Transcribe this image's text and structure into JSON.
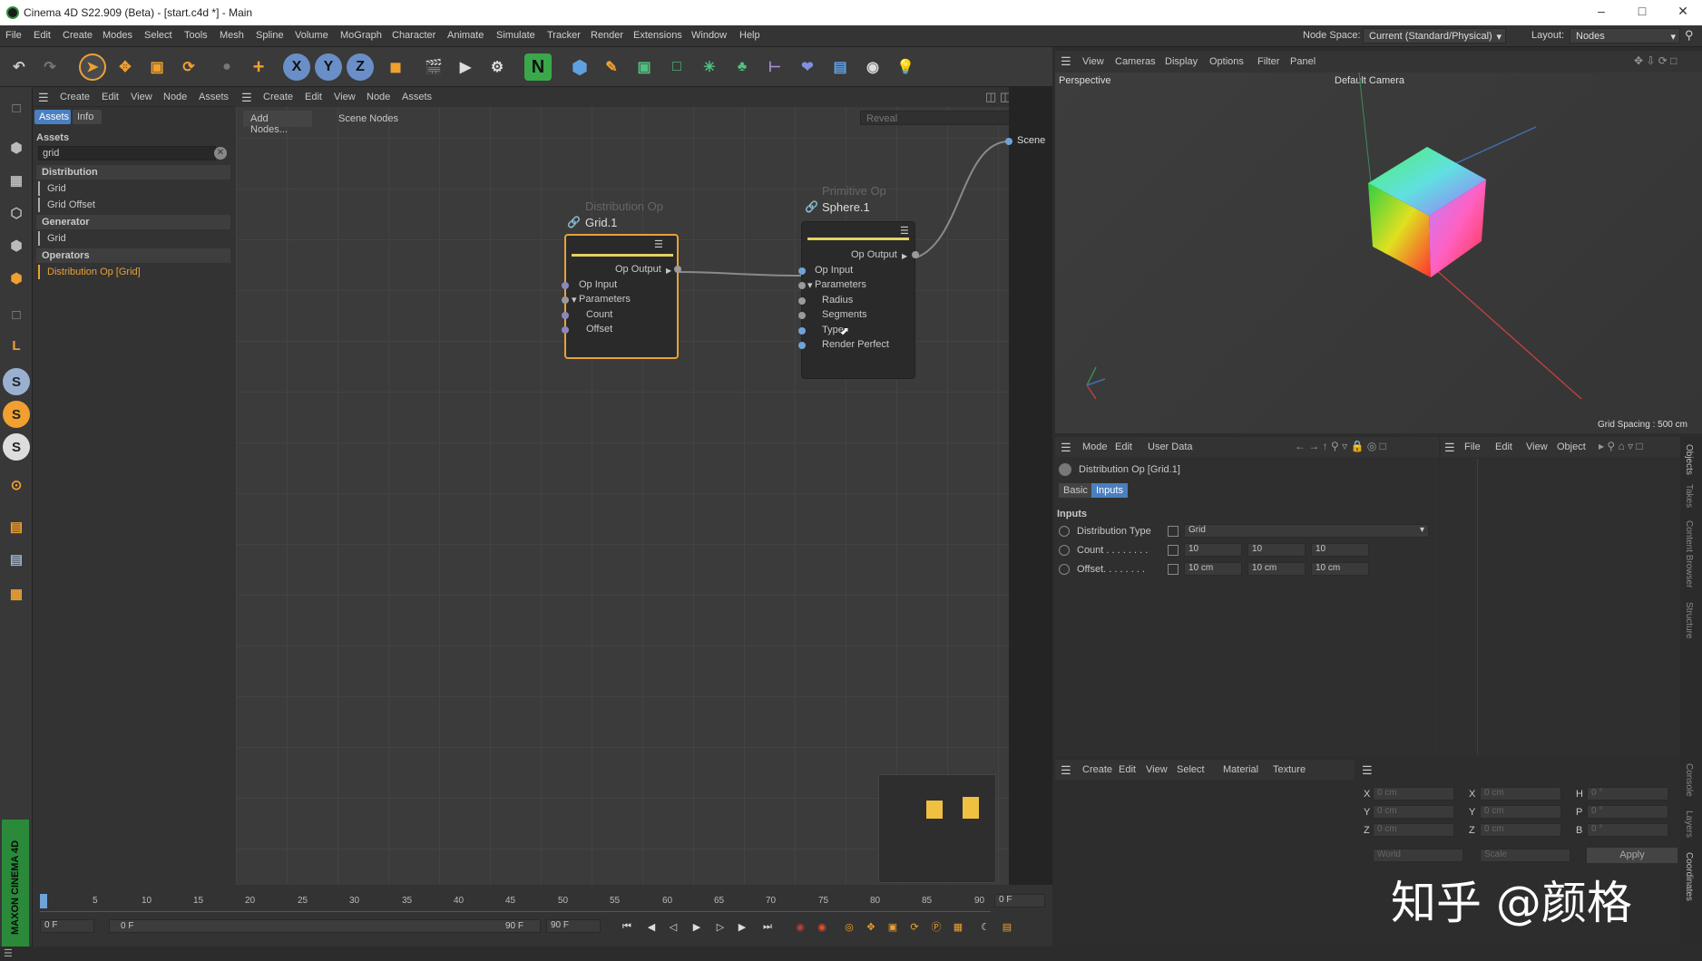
{
  "app": {
    "title": "Cinema 4D S22.909 (Beta) - [start.c4d *] - Main"
  },
  "menu": [
    "File",
    "Edit",
    "Create",
    "Modes",
    "Select",
    "Tools",
    "Mesh",
    "Spline",
    "Volume",
    "MoGraph",
    "Character",
    "Animate",
    "Simulate",
    "Tracker",
    "Render",
    "Extensions",
    "Window",
    "Help"
  ],
  "nodespace": {
    "label": "Node Space:",
    "value": "Current (Standard/Physical)",
    "layout_label": "Layout:",
    "layout_value": "Nodes"
  },
  "toolbar": {
    "x": "X",
    "y": "Y",
    "z": "Z",
    "n": "N"
  },
  "assets": {
    "menu": [
      "Create",
      "Edit",
      "View",
      "Node",
      "Assets"
    ],
    "tabs": [
      "Assets",
      "Info"
    ],
    "title": "Assets",
    "search": "grid",
    "groups": [
      {
        "name": "Distribution",
        "items": [
          "Grid",
          "Grid Offset"
        ]
      },
      {
        "name": "Generator",
        "items": [
          "Grid"
        ]
      },
      {
        "name": "Operators",
        "items": [
          "Distribution Op [Grid]"
        ]
      }
    ]
  },
  "nodeeditor": {
    "add_nodes": "Add Nodes...",
    "scene_nodes": "Scene Nodes",
    "reveal_placeholder": "Reveal",
    "scene": "Scene",
    "node1": {
      "type": "Distribution Op",
      "name": "Grid.1",
      "output": "Op Output",
      "ports": [
        "Op Input",
        "Parameters",
        "Count",
        "Offset"
      ]
    },
    "node2": {
      "type": "Primitive Op",
      "name": "Sphere.1",
      "output": "Op Output",
      "ports": [
        "Op Input",
        "Parameters",
        "Radius",
        "Segments",
        "Type",
        "Render Perfect"
      ]
    }
  },
  "viewport": {
    "menu": [
      "View",
      "Cameras",
      "Display",
      "Options",
      "Filter",
      "Panel"
    ],
    "name": "Perspective",
    "camera": "Default Camera",
    "grid_spacing": "Grid Spacing : 500 cm"
  },
  "attributes": {
    "menu": [
      "Mode",
      "Edit",
      "User Data"
    ],
    "object": "Distribution Op [Grid.1]",
    "tabs": [
      "Basic",
      "Inputs"
    ],
    "section": "Inputs",
    "dist_label": "Distribution Type",
    "dist_value": "Grid",
    "count_label": "Count . . . . . . . .",
    "count": [
      "10",
      "10",
      "10"
    ],
    "offset_label": "Offset. . . . . . . .",
    "offset": [
      "10 cm",
      "10 cm",
      "10 cm"
    ]
  },
  "objects": {
    "menu": [
      "File",
      "Edit",
      "View",
      "Object"
    ]
  },
  "materials": {
    "menu": [
      "Create",
      "Edit",
      "View",
      "Select",
      "Material",
      "Texture"
    ]
  },
  "coords": {
    "rows": [
      {
        "a": "X",
        "av": "0 cm",
        "b": "X",
        "bv": "0 cm",
        "c": "H",
        "cv": "0 °"
      },
      {
        "a": "Y",
        "av": "0 cm",
        "b": "Y",
        "bv": "0 cm",
        "c": "P",
        "cv": "0 °"
      },
      {
        "a": "Z",
        "av": "0 cm",
        "b": "Z",
        "bv": "0 cm",
        "c": "B",
        "cv": "0 °"
      }
    ],
    "world": "World",
    "scale": "Scale",
    "apply": "Apply"
  },
  "sidetabs": [
    "Objects",
    "Takes",
    "Content Browser",
    "Structure",
    "Console",
    "Layers",
    "Coordinates"
  ],
  "timeline": {
    "ticks": [
      "0",
      "5",
      "10",
      "15",
      "20",
      "25",
      "30",
      "35",
      "40",
      "45",
      "50",
      "55",
      "60",
      "65",
      "70",
      "75",
      "80",
      "85",
      "90"
    ],
    "cur": "0 F",
    "start": "0 F",
    "range_start": "0 F",
    "range_end": "90 F",
    "end": "90 F"
  },
  "watermark": "知乎 @颜格",
  "brand": "MAXON CINEMA 4D",
  "colors": {
    "accent": "#e8a23a",
    "node_sel": "#e8a23a",
    "tab_active": "#4a7fc0"
  }
}
